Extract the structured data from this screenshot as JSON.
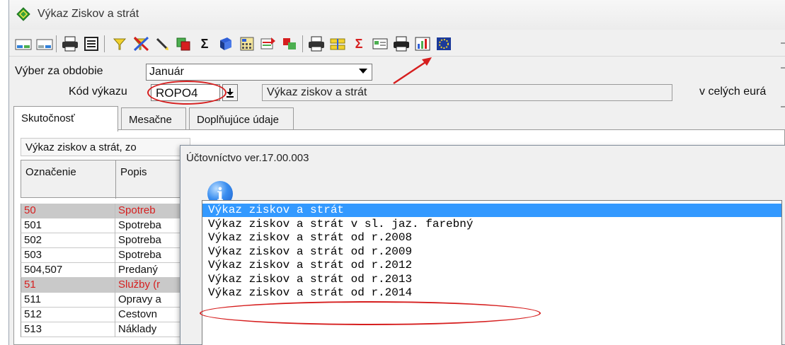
{
  "window": {
    "title": "Výkaz Ziskov a strát"
  },
  "toolbar": {
    "buttons": [
      {
        "icon": "import-left-icon"
      },
      {
        "icon": "import-right-icon"
      },
      {
        "icon": "printer-icon"
      },
      {
        "icon": "document-icon"
      },
      {
        "icon": "filter-icon"
      },
      {
        "icon": "clear-filter-icon"
      },
      {
        "icon": "pen-icon"
      },
      {
        "icon": "copy-icon"
      },
      {
        "icon": "sum-icon"
      },
      {
        "icon": "book-icon"
      },
      {
        "icon": "calculator-icon"
      },
      {
        "icon": "export-icon"
      },
      {
        "icon": "windows-icon"
      },
      {
        "icon": "print-report-icon"
      },
      {
        "icon": "ruler-icon"
      },
      {
        "icon": "sigma-icon"
      },
      {
        "icon": "card-icon"
      },
      {
        "icon": "printer-alt-icon"
      },
      {
        "icon": "chart-icon"
      },
      {
        "icon": "globe-icon"
      }
    ]
  },
  "period": {
    "label": "Výber za obdobie",
    "value": "Január"
  },
  "report_code": {
    "label": "Kód výkazu",
    "value": "ROPO4",
    "description": "Výkaz ziskov a strát",
    "units": "v celých eurá"
  },
  "tabs": [
    {
      "label": "Skutočnosť"
    },
    {
      "label": "Mesačne"
    },
    {
      "label": "Doplňujúce údaje"
    }
  ],
  "grid": {
    "caption": "Výkaz ziskov a strát, zo",
    "columns": [
      "Označenie",
      "Popis"
    ],
    "rows": [
      {
        "code": "50",
        "desc": "Spotreb",
        "group": true
      },
      {
        "code": "501",
        "desc": "Spotreba",
        "group": false
      },
      {
        "code": "502",
        "desc": "Spotreba",
        "group": false
      },
      {
        "code": "503",
        "desc": "Spotreba",
        "group": false
      },
      {
        "code": "504,507",
        "desc": "Predaný",
        "group": false
      },
      {
        "code": "51",
        "desc": "Služby (r",
        "group": true
      },
      {
        "code": "511",
        "desc": "Opravy a",
        "group": false
      },
      {
        "code": "512",
        "desc": "Cestovn",
        "group": false
      },
      {
        "code": "513",
        "desc": "Náklady",
        "group": false
      }
    ]
  },
  "dialog": {
    "title": "Účtovníctvo ver.17.00.003",
    "items": [
      "Výkaz ziskov a strát",
      "Výkaz ziskov a strát v sl. jaz. farebný",
      "Výkaz ziskov a strát od r.2008",
      "Výkaz ziskov a strát od r.2009",
      "Výkaz ziskov a strát od r.2012",
      "Výkaz ziskov a strát od r.2013",
      "Výkaz ziskov a strát od r.2014"
    ],
    "selected_index": 0
  },
  "colors": {
    "accent": "#3399ff",
    "annotation": "#d61f1f",
    "group_row": "#c9c9c9"
  }
}
